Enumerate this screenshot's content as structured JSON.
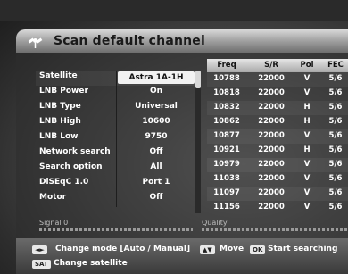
{
  "title": "Scan default channel",
  "settings": [
    {
      "label": "Satellite",
      "value": "Astra 1A-1H",
      "selected": true
    },
    {
      "label": "LNB Power",
      "value": "On"
    },
    {
      "label": "LNB Type",
      "value": "Universal"
    },
    {
      "label": "LNB High",
      "value": "10600"
    },
    {
      "label": "LNB Low",
      "value": "9750"
    },
    {
      "label": "Network search",
      "value": "Off"
    },
    {
      "label": "Search option",
      "value": "All"
    },
    {
      "label": "DiSEqC 1.0",
      "value": "Port 1"
    },
    {
      "label": "Motor",
      "value": "Off"
    }
  ],
  "table": {
    "headers": [
      "Freq",
      "S/R",
      "Pol",
      "FEC"
    ],
    "rows": [
      [
        "10788",
        "22000",
        "V",
        "5/6"
      ],
      [
        "10818",
        "22000",
        "V",
        "5/6"
      ],
      [
        "10832",
        "22000",
        "H",
        "5/6"
      ],
      [
        "10862",
        "22000",
        "H",
        "5/6"
      ],
      [
        "10877",
        "22000",
        "V",
        "5/6"
      ],
      [
        "10921",
        "22000",
        "H",
        "5/6"
      ],
      [
        "10979",
        "22000",
        "V",
        "5/6"
      ],
      [
        "11038",
        "22000",
        "V",
        "5/6"
      ],
      [
        "11097",
        "22000",
        "V",
        "5/6"
      ],
      [
        "11156",
        "22000",
        "V",
        "5/6"
      ]
    ]
  },
  "signal": {
    "label": "Signal 0",
    "quality_label": "Quality"
  },
  "footer": {
    "key1": "◄►",
    "hint1": "Change mode [Auto / Manual]",
    "key2": "▲▼",
    "hint2": "Move",
    "key3": "OK",
    "hint3": "Start searching",
    "key4": "SAT",
    "hint4": "Change satellite"
  }
}
